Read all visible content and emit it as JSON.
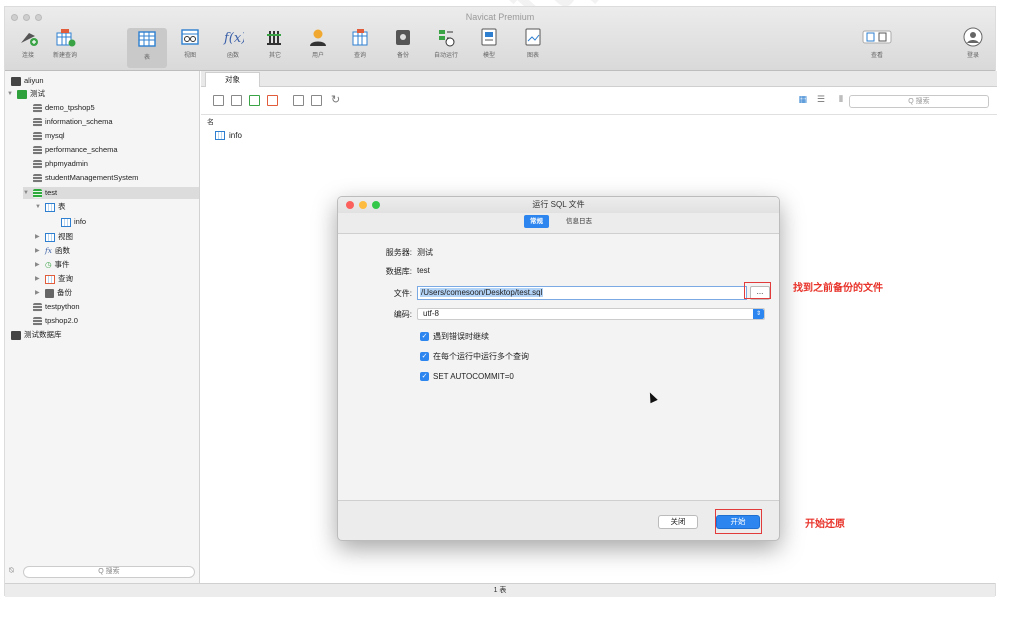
{
  "window": {
    "title": "Navicat Premium"
  },
  "toolbar": [
    {
      "label": "连接",
      "icon": "connection-icon"
    },
    {
      "label": "新建查询",
      "icon": "new-query-icon"
    },
    {
      "label": "表",
      "icon": "table-icon"
    },
    {
      "label": "视图",
      "icon": "view-icon"
    },
    {
      "label": "函数",
      "icon": "function-icon"
    },
    {
      "label": "其它",
      "icon": "other-icon"
    },
    {
      "label": "用户",
      "icon": "user-icon"
    },
    {
      "label": "查询",
      "icon": "query-icon"
    },
    {
      "label": "备份",
      "icon": "backup-icon"
    },
    {
      "label": "自动运行",
      "icon": "automation-icon"
    },
    {
      "label": "模型",
      "icon": "model-icon"
    },
    {
      "label": "图表",
      "icon": "chart-icon"
    },
    {
      "label": "查看",
      "icon": "view-toggle-icon"
    },
    {
      "label": "登录",
      "icon": "login-icon"
    }
  ],
  "sidebar": {
    "items": [
      "aliyun",
      "测试",
      "demo_tpshop5",
      "information_schema",
      "mysql",
      "performance_schema",
      "phpmyadmin",
      "studentManagementSystem",
      "test",
      "表",
      "info",
      "视图",
      "函数",
      "事件",
      "查询",
      "备份",
      "testpython",
      "tpshop2.0",
      "测试数据库"
    ],
    "search_placeholder": "Q 搜索"
  },
  "main": {
    "tab": "对象",
    "search_placeholder": "Q 搜索",
    "column_header": "名",
    "object": "info",
    "status": "1 表"
  },
  "dialog": {
    "title": "运行 SQL 文件",
    "tab_general": "常规",
    "tab_log": "信息日志",
    "server_label": "服务器:",
    "server_value": "测试",
    "database_label": "数据库:",
    "database_value": "test",
    "file_label": "文件:",
    "file_value": "/Users/comesoon/Desktop/test.sql",
    "browse_label": "...",
    "encoding_label": "编码:",
    "encoding_value": "utf-8",
    "options": [
      "遇到错误时继续",
      "在每个运行中运行多个查询",
      "SET AUTOCOMMIT=0"
    ],
    "close_label": "关闭",
    "start_label": "开始"
  },
  "annotations": {
    "find_file": "找到之前备份的文件",
    "start_restore": "开始还原",
    "color": "#e8332a"
  }
}
